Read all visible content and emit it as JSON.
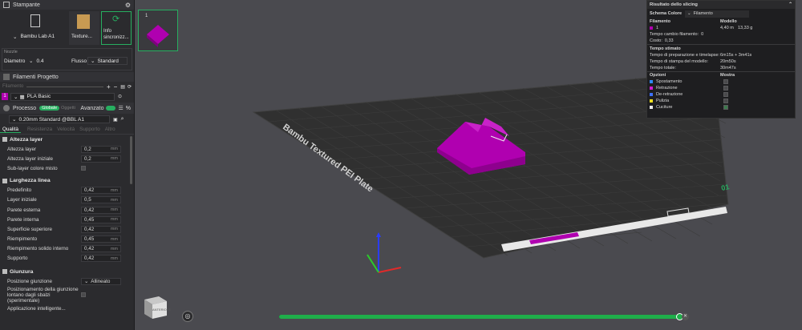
{
  "printer": {
    "title": "Stampante",
    "printer_name": "Bambu Lab A1",
    "plate_label": "Texture...",
    "sync_label": "Info sincronizz...",
    "nozzle_label": "Nozzle",
    "diameter_label": "Diametro",
    "diameter_value": "0.4",
    "flow_label": "Flusso",
    "flow_value": "Standard"
  },
  "filament": {
    "title": "Filamenti Progetto",
    "filter_label": "Filamento",
    "items": [
      {
        "index": "1",
        "name": "PLA Basic",
        "color": "#b000b0"
      }
    ]
  },
  "process": {
    "title": "Processo",
    "global_label": "Globale",
    "objects_label": "Oggetti",
    "advanced_label": "Avanzato",
    "preset": "0.20mm Standard @BBL A1",
    "tabs": [
      "Qualità",
      "Resistenza",
      "Velocità",
      "Supporto",
      "Altro"
    ],
    "layer_height": {
      "title": "Altezza layer",
      "rows": [
        {
          "label": "Altezza layer",
          "value": "0,2",
          "unit": "mm"
        },
        {
          "label": "Altezza layer iniziale",
          "value": "0,2",
          "unit": "mm"
        }
      ],
      "mixed_color_label": "Sub-layer colore misto"
    },
    "line_width": {
      "title": "Larghezza linea",
      "rows": [
        {
          "label": "Predefinito",
          "value": "0,42",
          "unit": "mm"
        },
        {
          "label": "Layer iniziale",
          "value": "0,5",
          "unit": "mm"
        },
        {
          "label": "Parete esterna",
          "value": "0,42",
          "unit": "mm"
        },
        {
          "label": "Parete interna",
          "value": "0,45",
          "unit": "mm"
        },
        {
          "label": "Superficie superiore",
          "value": "0,42",
          "unit": "mm"
        },
        {
          "label": "Riempimento",
          "value": "0,45",
          "unit": "mm"
        },
        {
          "label": "Riempimento solido interno",
          "value": "0,42",
          "unit": "mm"
        },
        {
          "label": "Supporto",
          "value": "0,42",
          "unit": "mm"
        }
      ]
    },
    "seam": {
      "title": "Giunzura",
      "position_label": "Posizione giunzione",
      "position_value": "Allineato",
      "far_label": "Posizionamento della giunzione lontano dagli sbalzi (sperimentale)",
      "cut_label": "Applicazione intelligente..."
    }
  },
  "plate_thumb": {
    "number": "1"
  },
  "bed": {
    "label": "Bambu Textured PEI Plate",
    "plate_number": "01"
  },
  "results": {
    "title": "Risultato dello slicing",
    "scheme_label": "Schema Colore",
    "scheme_value": "Filamento",
    "col_filament": "Filamento",
    "col_model": "Modello",
    "filament_index": "1",
    "filament_length": "4,40 m",
    "filament_weight": "13,33 g",
    "change_time_label": "Tempo cambio filamento:",
    "change_time_value": "0",
    "cost_label": "Costo:",
    "cost_value": "0,33",
    "est_title": "Tempo stimato",
    "prep_label": "Tempo di preparazione e timelapse:",
    "prep_value": "6m15s + 3m41s",
    "model_time_label": "Tempo di stampa del modello:",
    "model_time_value": "20m50s",
    "total_label": "Tempo totale:",
    "total_value": "30m47s",
    "options_label": "Opzioni",
    "show_label": "Mostra",
    "options": [
      {
        "label": "Spostamento",
        "color": "#2e8bff"
      },
      {
        "label": "Retrazione",
        "color": "#d01cd0"
      },
      {
        "label": "De-retrazione",
        "color": "#3d70ff"
      },
      {
        "label": "Pulizia",
        "color": "#f0e020"
      },
      {
        "label": "Cuciture",
        "color": "#e8e8e8"
      }
    ]
  },
  "nav_cube": {
    "label": "ANTERIORE"
  },
  "slider": {
    "progress": 1.0,
    "color": "#1fae4a"
  }
}
